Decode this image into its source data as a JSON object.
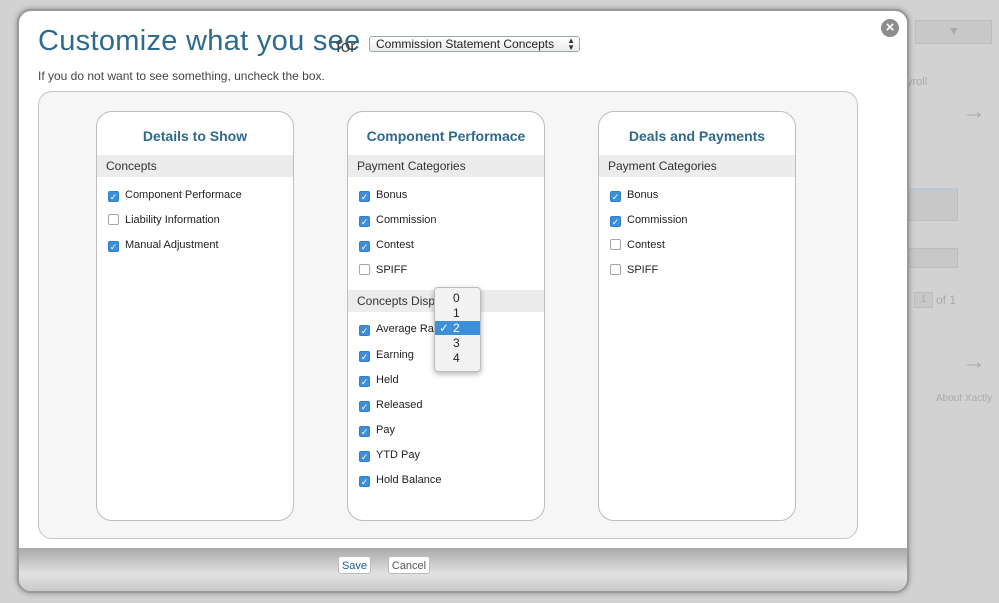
{
  "background": {
    "tab_text": "yroll",
    "pager_input": "1",
    "pager_of": "of 1",
    "about_link": "About Xactly",
    "arrow_glyph": "→",
    "caret_glyph": "▼"
  },
  "dialog": {
    "title": "Customize what you see",
    "for_label": "for",
    "selected_view": "Commission Statement Concepts",
    "instruction": "If you do not want to see something, uncheck the box.",
    "close_glyph": "×"
  },
  "cards": [
    {
      "title": "Details to Show",
      "sections": [
        {
          "header": "Concepts",
          "items": [
            {
              "label": "Component Performace",
              "checked": true
            },
            {
              "label": "Liability Information",
              "checked": false
            },
            {
              "label": "Manual Adjustment",
              "checked": true
            }
          ]
        }
      ]
    },
    {
      "title": "Component Performace",
      "sections": [
        {
          "header": "Payment Categories",
          "items": [
            {
              "label": "Bonus",
              "checked": true
            },
            {
              "label": "Commission",
              "checked": true
            },
            {
              "label": "Contest",
              "checked": true
            },
            {
              "label": "SPIFF",
              "checked": false
            }
          ]
        },
        {
          "header": "Concepts Displa",
          "items": [
            {
              "label": "Average Rate",
              "checked": true
            },
            {
              "label": "Earning",
              "checked": true
            },
            {
              "label": "Held",
              "checked": true
            },
            {
              "label": "Released",
              "checked": true
            },
            {
              "label": "Pay",
              "checked": true
            },
            {
              "label": "YTD Pay",
              "checked": true
            },
            {
              "label": "Hold Balance",
              "checked": true
            }
          ]
        }
      ]
    },
    {
      "title": "Deals and Payments",
      "sections": [
        {
          "header": "Payment Categories",
          "items": [
            {
              "label": "Bonus",
              "checked": true
            },
            {
              "label": "Commission",
              "checked": true
            },
            {
              "label": "Contest",
              "checked": false
            },
            {
              "label": "SPIFF",
              "checked": false
            }
          ]
        }
      ]
    }
  ],
  "decimal_dropdown": {
    "options": [
      "0",
      "1",
      "2",
      "3",
      "4"
    ],
    "selected": "2",
    "check_glyph": "✓"
  },
  "footer": {
    "save_label": "Save",
    "cancel_label": "Cancel"
  },
  "colors": {
    "title": "#2d6a8e",
    "checkbox_on": "#3d8fd9",
    "section_bg": "#ececec"
  }
}
